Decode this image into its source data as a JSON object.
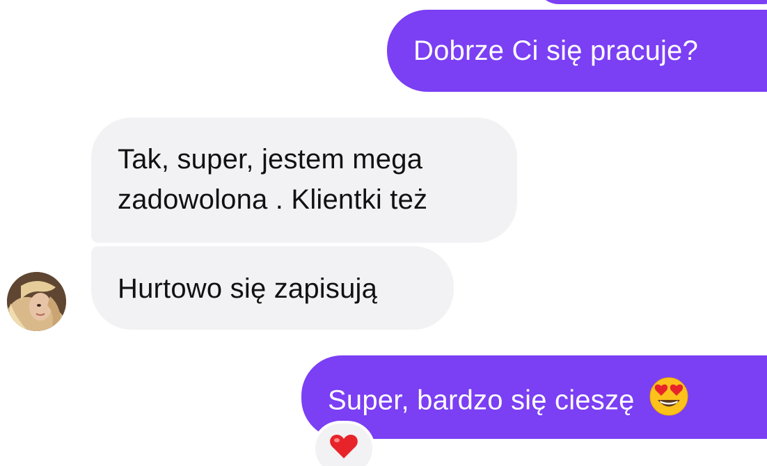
{
  "conversation": {
    "messages": [
      {
        "sender": "me",
        "text": "Dobrze Ci się pracuje?"
      },
      {
        "sender": "contact",
        "lines": [
          "Tak, super, jestem mega",
          "zadowolona . Klientki też"
        ]
      },
      {
        "sender": "contact",
        "text": "Hurtowo się zapisują"
      },
      {
        "sender": "me",
        "text": "Super, bardzo się cieszę",
        "emoji": "heart-eyes-emoji",
        "reaction": "heart-emoji"
      }
    ]
  },
  "colors": {
    "outgoing_bubble": "#7b3ff4",
    "incoming_bubble": "#f2f2f4",
    "outgoing_text": "#ffffff",
    "incoming_text": "#111111"
  }
}
